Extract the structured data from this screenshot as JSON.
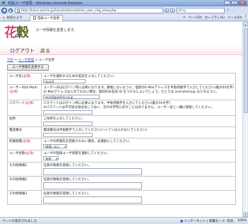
{
  "window": {
    "title": "花穀ユーザ変更 - Windows Internet Explorer",
    "buttons": [
      "_",
      "□",
      "✕"
    ]
  },
  "address_bar": {
    "url": "http://hana.animo.jp/hana/admin/admin_user_chg_view.php",
    "search_placeholder": "Bing"
  },
  "toolbar": {
    "favorites": "お気に入り",
    "tab_title": "花穀ユーザ変更",
    "right_items": [
      "ページ(P)",
      "セーフティ(S)",
      "ツール(O)"
    ]
  },
  "page": {
    "logo_main": "花",
    "logo_sub": "穀",
    "intro": "ユーザ情報を変更します。",
    "nav": [
      "ログアウト",
      "戻る"
    ],
    "breadcrumb": [
      "TOP",
      "ユーザ管理",
      "ユーザ変更"
    ],
    "breadcrumb_sep": " > ",
    "register_button": "ユーザ情報を変更する",
    "required_mark": "(必須)"
  },
  "form_rows": [
    {
      "label": "ユーザ名",
      "required": true,
      "hints": [
        "ユーザを識別するための名前を入力してください。"
      ],
      "value": "record",
      "kind": "input"
    },
    {
      "label": "ユーザーID(E-Mail)",
      "required": true,
      "hints": [
        "ユーザーIDはログイン時に必要になります。重複しないように、個別のE-Mailアドレスを半角英数字で入力してください(最大64文字)",
        "(E-Mailアドレスは入力でもない場合、個別のお名前 ID をつけるとよいでしょう。たとえば animations@ などのように。"
      ],
      "value": "record@animo.co.jp",
      "kind": "input"
    },
    {
      "label": "パスワード",
      "required": true,
      "hints": [
        "パスワードはログイン時に必要になります。半角英数字を入力してください(最大16文字)",
        "※パスワードは不可逆な暗号化しておい、元の文字列に戻すことはありません。ユーザー名と一緒に保管してください。"
      ],
      "value": "",
      "kind": "input"
    },
    {
      "label": "住所",
      "required": false,
      "hints": [
        "ご住所を入力してください。"
      ],
      "value": "",
      "kind": "input"
    },
    {
      "label": "電話番号",
      "required": false,
      "hints": [
        "電話番号は半角数字で入力してください(ハイフンは入れないでください)"
      ],
      "value": "",
      "kind": "input"
    },
    {
      "label": "所属部署",
      "required": true,
      "hints": [
        "ユーザの所属先を登録されない場合、未選択にしてください。"
      ],
      "value": "経理しない",
      "kind": "select"
    },
    {
      "label": "ユーザ状態",
      "required": true,
      "hints": [
        "ユーザの登録ユーザ状態を選択してください。"
      ],
      "value": "有効",
      "kind": "select"
    },
    {
      "label": "その他情報1",
      "required": false,
      "hints": [
        "任意の情報を登録してください。"
      ],
      "value": "",
      "kind": "textarea"
    },
    {
      "label": "その他情報2",
      "required": false,
      "hints": [
        "任意の情報を登録してください。"
      ],
      "value": "",
      "kind": "textarea"
    },
    {
      "label": "その他情報3",
      "required": false,
      "hints": [
        "任意の情報を登録してください。"
      ],
      "value": "",
      "kind": "textarea"
    }
  ],
  "status_bar": {
    "left": "ページが表示されました",
    "zone": "インターネット | 保護モード: 有効",
    "zoom": "100%"
  },
  "colors": {
    "required": "#d21e1e",
    "logo": "#c04a7a",
    "link": "#2b54b4"
  }
}
